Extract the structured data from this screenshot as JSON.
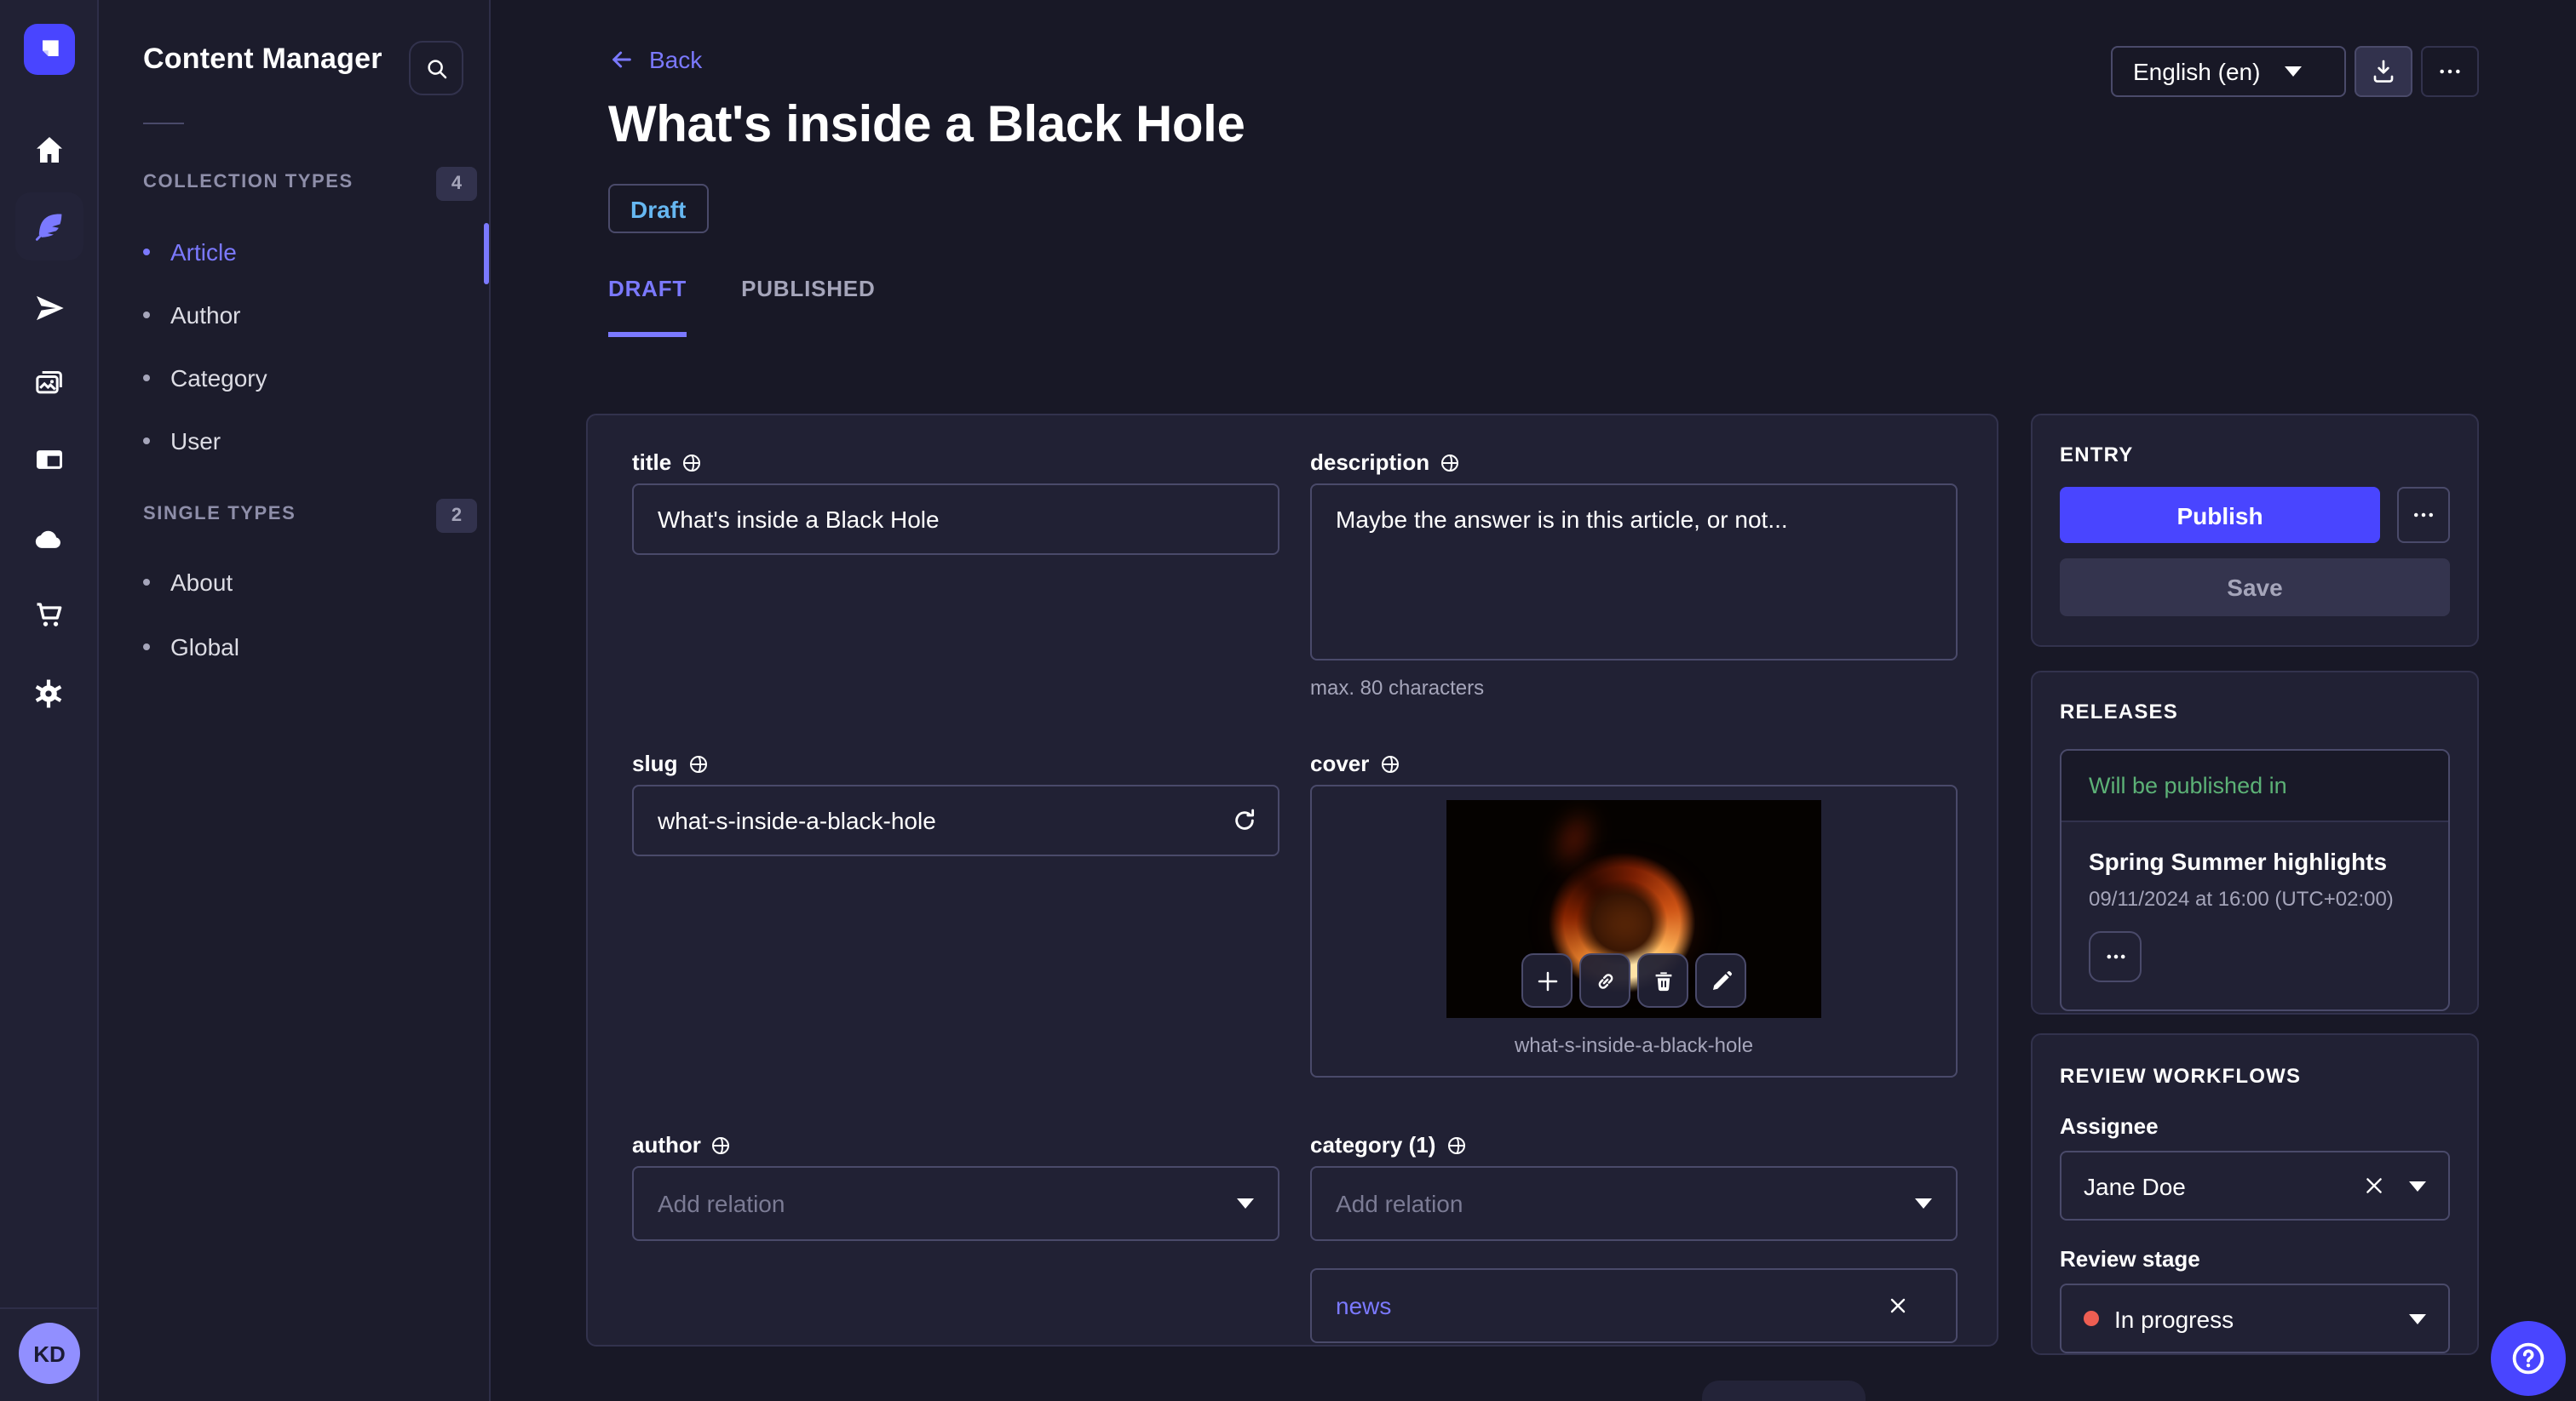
{
  "rail": {
    "icons": [
      "home-icon",
      "feather-icon",
      "send-icon",
      "media-icon",
      "layout-icon",
      "cloud-icon",
      "cart-icon",
      "gear-icon"
    ],
    "active_icon": "feather-icon",
    "avatar_initials": "KD"
  },
  "subnav": {
    "title": "Content Manager",
    "sections": [
      {
        "label": "COLLECTION TYPES",
        "count": "4",
        "items": [
          {
            "label": "Article",
            "active": true
          },
          {
            "label": "Author"
          },
          {
            "label": "Category"
          },
          {
            "label": "User"
          }
        ]
      },
      {
        "label": "SINGLE TYPES",
        "count": "2",
        "items": [
          {
            "label": "About"
          },
          {
            "label": "Global"
          }
        ]
      }
    ]
  },
  "header": {
    "back_label": "Back",
    "title": "What's inside a Black Hole",
    "status_badge": "Draft",
    "locale": "English (en)",
    "tabs": [
      {
        "label": "DRAFT",
        "active": true
      },
      {
        "label": "PUBLISHED"
      }
    ]
  },
  "form": {
    "title": {
      "label": "title",
      "value": "What's inside a Black Hole"
    },
    "description": {
      "label": "description",
      "value": "Maybe the answer is in this article, or not...",
      "hint": "max. 80 characters"
    },
    "slug": {
      "label": "slug",
      "value": "what-s-inside-a-black-hole"
    },
    "cover": {
      "label": "cover",
      "caption": "what-s-inside-a-black-hole"
    },
    "author": {
      "label": "author",
      "placeholder": "Add relation"
    },
    "category": {
      "label": "category (1)",
      "placeholder": "Add relation",
      "relations": [
        {
          "label": "news"
        }
      ]
    }
  },
  "entry_panel": {
    "title": "ENTRY",
    "publish_label": "Publish",
    "save_label": "Save"
  },
  "releases_panel": {
    "title": "RELEASES",
    "status": "Will be published in",
    "release_name": "Spring Summer highlights",
    "release_date": "09/11/2024 at 16:00 (UTC+02:00)"
  },
  "review_panel": {
    "title": "REVIEW WORKFLOWS",
    "assignee_label": "Assignee",
    "assignee_value": "Jane Doe",
    "stage_label": "Review stage",
    "stage_value": "In progress"
  },
  "colors": {
    "primary": "#4945ff",
    "primary_light": "#7b79ff",
    "draft_blue": "#66b7f1",
    "success_green": "#5cb176",
    "danger_red": "#ee5e52",
    "surface": "#212134",
    "background": "#181826",
    "border": "#32324d",
    "muted_text": "#a5a5ba"
  }
}
